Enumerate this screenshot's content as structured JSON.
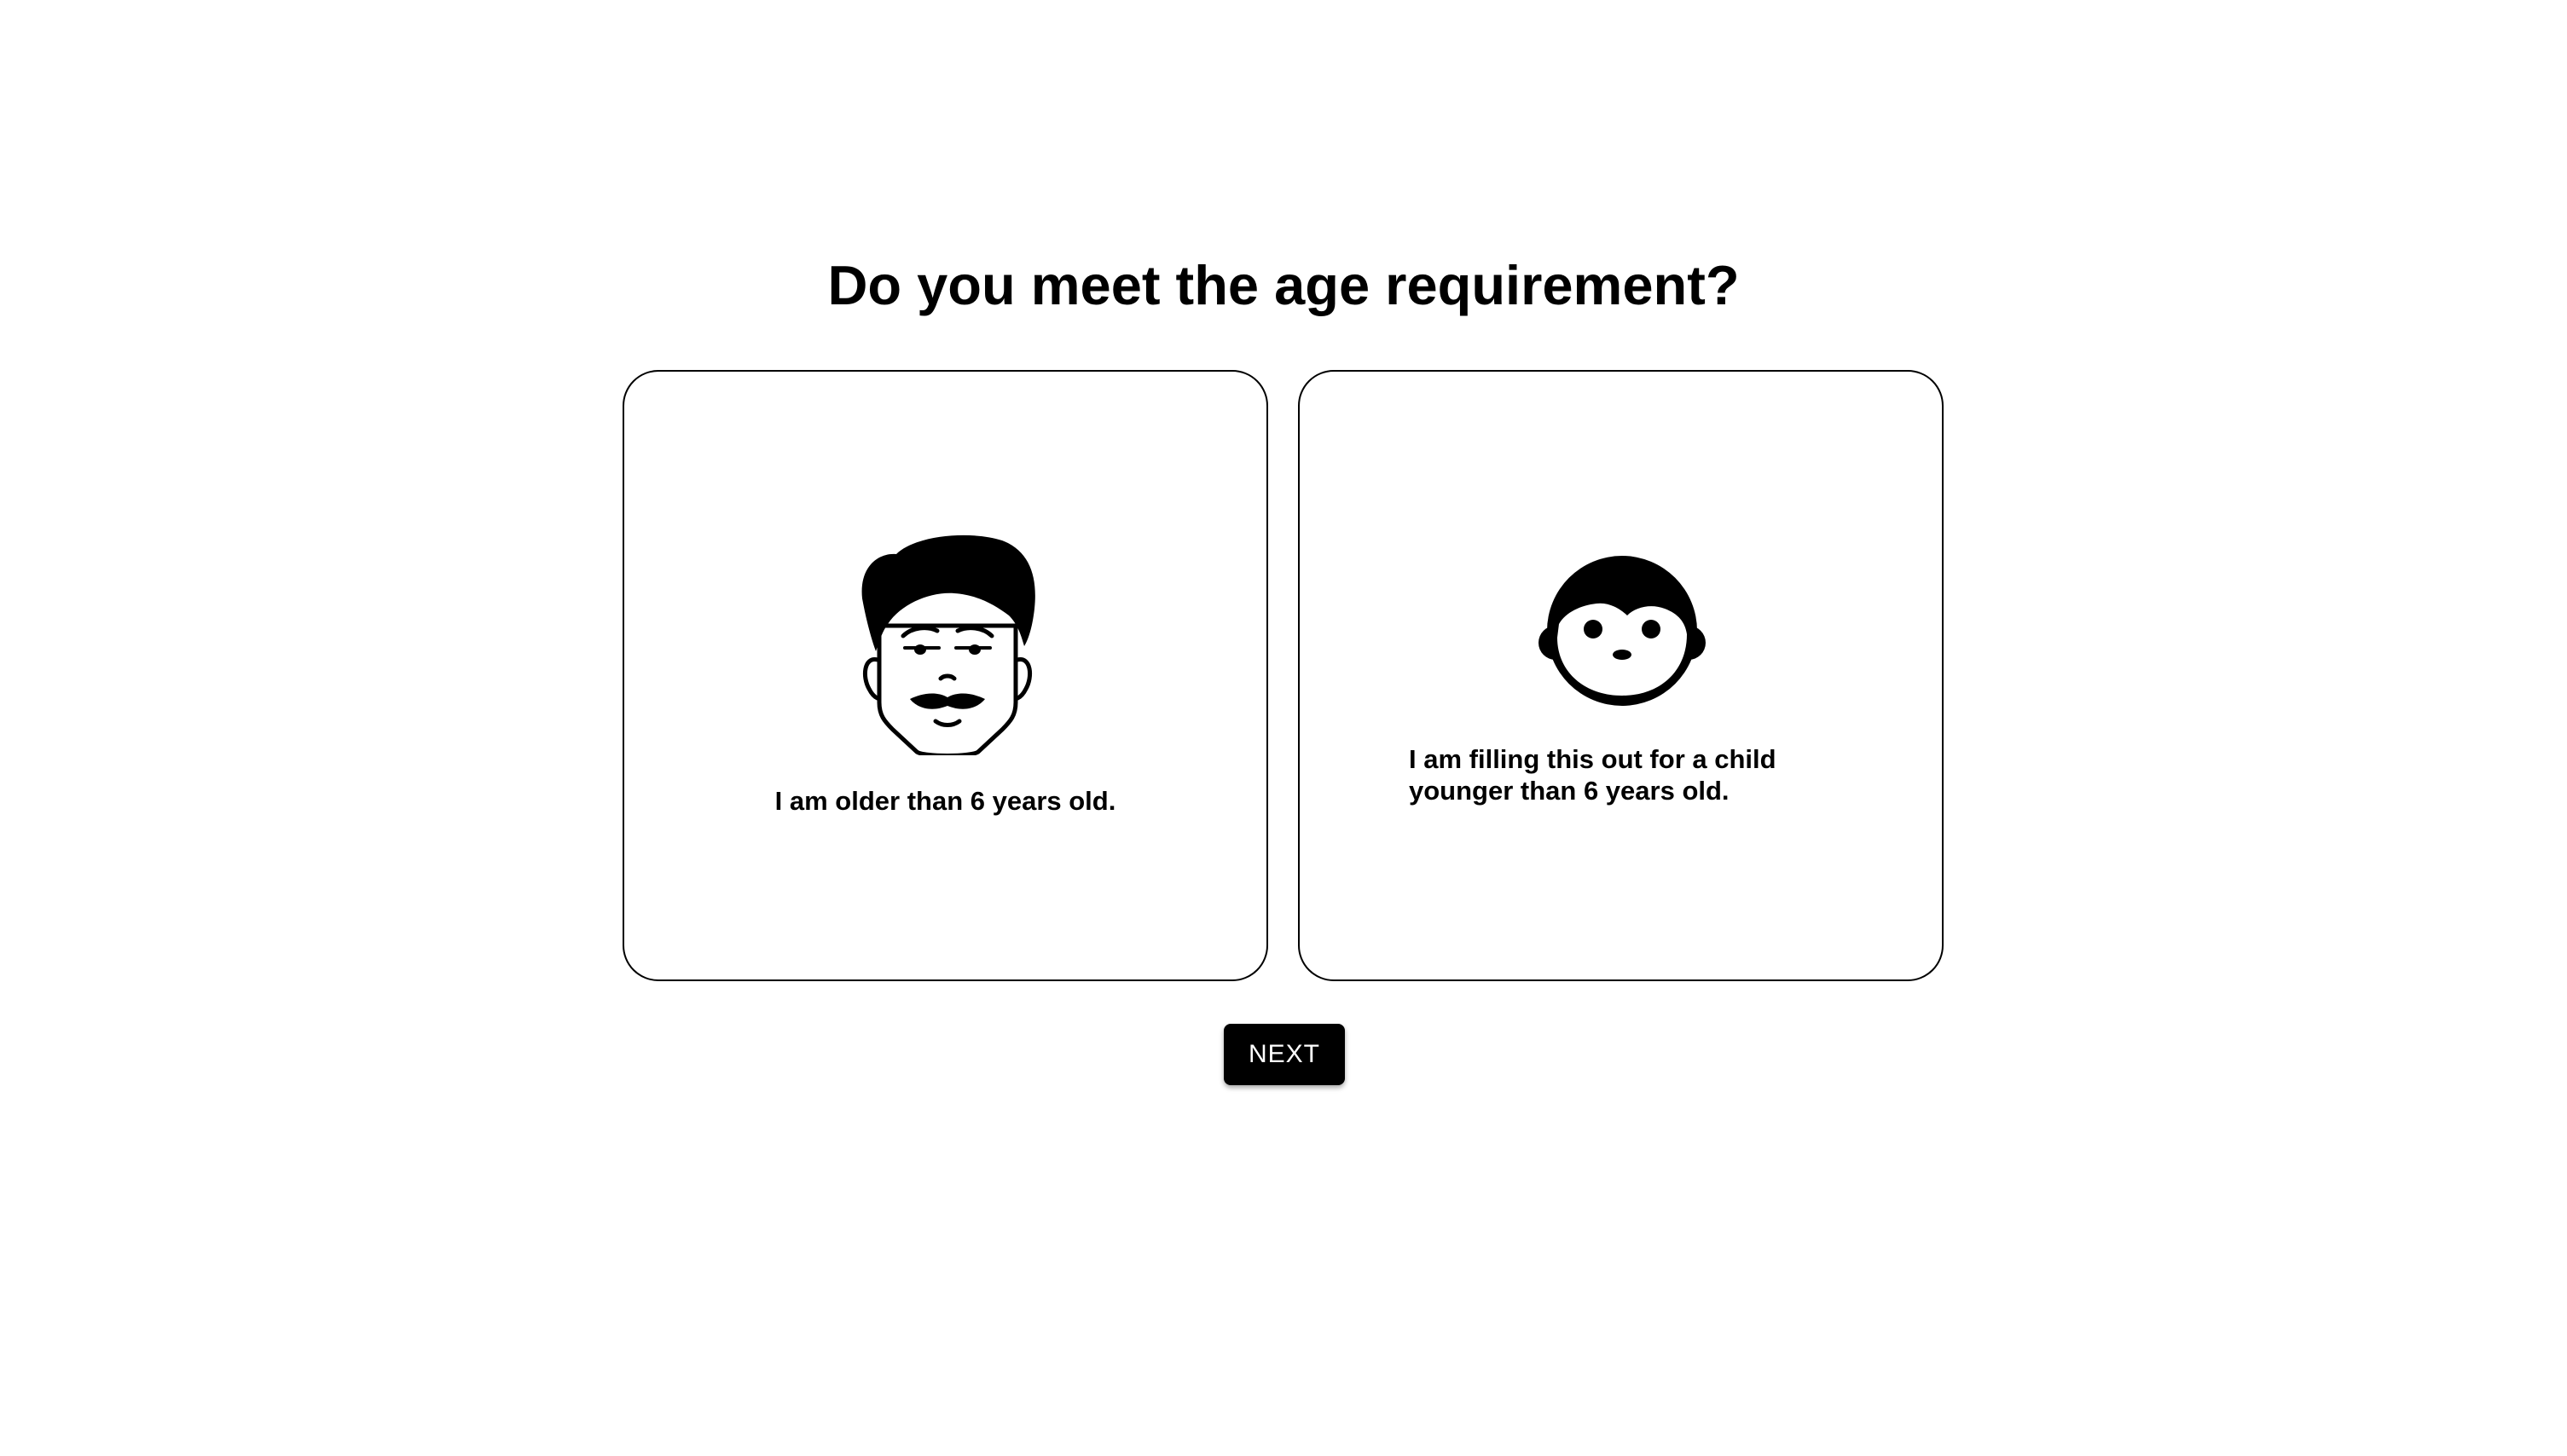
{
  "page": {
    "title": "Do you meet the age requirement?"
  },
  "options": [
    {
      "label": "I am older than 6 years old.",
      "icon": "adult-face-icon"
    },
    {
      "label_line1": "I am filling this out for a child",
      "label_line2": "younger than 6 years old.",
      "icon": "child-face-icon"
    }
  ],
  "actions": {
    "next_label": "NEXT"
  },
  "colors": {
    "background": "#ffffff",
    "text": "#000000",
    "button_bg": "#000000",
    "button_text": "#ffffff"
  }
}
